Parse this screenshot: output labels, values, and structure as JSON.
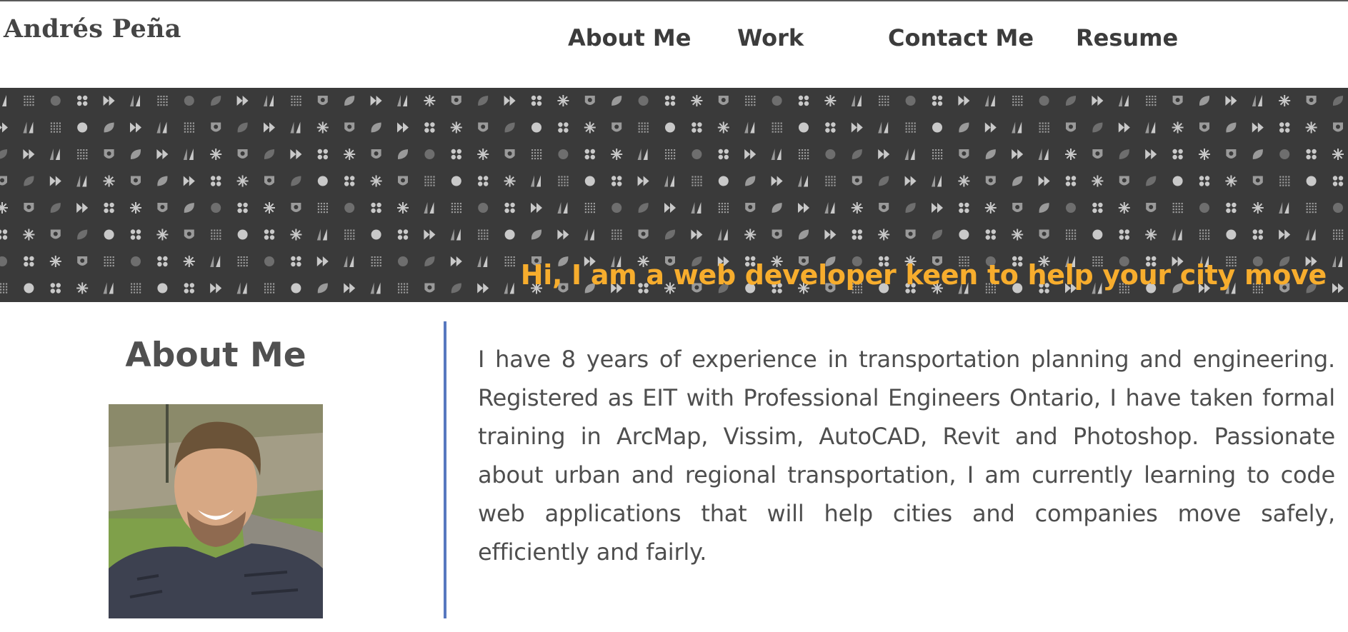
{
  "header": {
    "brand": "Andrés Peña",
    "nav": [
      {
        "label": "About Me"
      },
      {
        "label": "Work"
      },
      {
        "label": "Contact Me"
      },
      {
        "label": "Resume"
      }
    ]
  },
  "banner": {
    "tagline": "Hi, I am a web developer keen to help your city move",
    "pattern_icons": [
      "triangle-pair-icon",
      "dots-icon",
      "leaf-icon",
      "grid-icon",
      "star-icon",
      "double-arrow-icon",
      "circle-icon",
      "shield-icon"
    ]
  },
  "about": {
    "title": "About Me",
    "bio": "I have 8 years of experience in transportation planning and engineering. Registered as EIT with Professional Engineers Ontario, I have taken formal training in ArcMap, Vissim, AutoCAD, Revit and Photoshop. Passionate about urban and regional transportation, I am currently learning to code web applications that will help cities and companies move safely, efficiently and fairly."
  },
  "colors": {
    "accent": "#f7ad2d",
    "divider": "#5778bf",
    "banner_bg": "#3a3a3a",
    "text": "#4e4e4e"
  }
}
